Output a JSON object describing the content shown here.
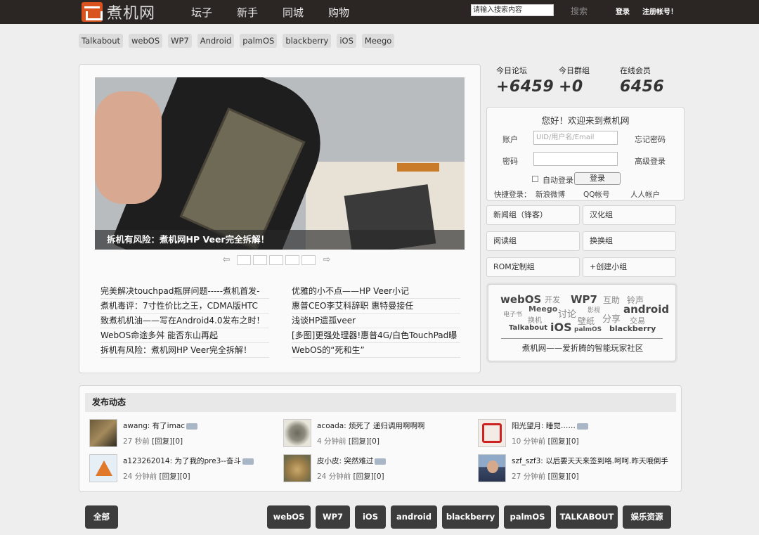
{
  "header": {
    "logo_text": "煮机网",
    "nav": [
      "坛子",
      "新手",
      "同城",
      "购物"
    ],
    "search_placeholder": "请输入搜索内容",
    "search_button": "搜索",
    "login": "登录",
    "register": "注册帐号！"
  },
  "tags": [
    "Talkabout",
    "webOS",
    "WP7",
    "Android",
    "palmOS",
    "blackberry",
    "iOS",
    "Meego"
  ],
  "slider": {
    "caption": "拆机有风险：煮机网HP Veer完全拆解！",
    "prev_arrow": "⇦",
    "next_arrow": "⇨"
  },
  "news_left": [
    "完美解决touchpad瓶屏问题-----煮机首发-",
    "煮机毒评：7寸性价比之王，CDMA版HTC",
    "致煮机机油——写在Android4.0发布之时！",
    "WebOS命途多舛 能否东山再起",
    "拆机有风险：煮机网HP Veer完全拆解！"
  ],
  "news_right": [
    "优雅的小不点——HP Veer小记",
    "惠普CEO李艾科辞职 惠特曼接任",
    "浅谈HP遗孤veer",
    "[多图]更强处理器!惠普4G/白色TouchPad曝",
    "WebOS的“死和生”"
  ],
  "stats": [
    {
      "label": "今日论坛",
      "value": "+6459"
    },
    {
      "label": "今日群组",
      "value": "+0"
    },
    {
      "label": "在线会员",
      "value": "6456"
    }
  ],
  "login": {
    "title": "您好！欢迎来到煮机网",
    "account_label": "账户",
    "account_placeholder": "UID/用户名/Email",
    "forgot": "忘记密码",
    "password_label": "密码",
    "advanced": "高级登录",
    "remember": "自动登录",
    "submit": "登录",
    "quick_label": "快捷登录：",
    "quick_weibo": "新浪微博",
    "quick_qq": "QQ帐号",
    "quick_renren": "人人帐户"
  },
  "groups": [
    "新闻组（锋客）",
    "汉化组",
    "阅读组",
    "换换组",
    "ROM定制组",
    "+创建小组"
  ],
  "cloud": {
    "words": [
      "webOS",
      "开发",
      "WP7",
      "互助",
      "铃声",
      "电子书",
      "Meego",
      "讨论",
      "影视",
      "android",
      "换机",
      "壁纸",
      "分享",
      "交易",
      "Talkabout",
      "iOS",
      "palmOS",
      "blackberry"
    ],
    "caption": "煮机网——爱折腾的智能玩家社区"
  },
  "activity": {
    "title": "发布动态",
    "reply_label": "[回复][0]",
    "items": [
      {
        "user": "awang",
        "text": "有了imac",
        "time": "27 秒前"
      },
      {
        "user": "acoada",
        "text": "烦死了 递归调用啊啊啊",
        "time": "4 分钟前"
      },
      {
        "user": "阳光望月",
        "text": "睡觉……",
        "time": "10 分钟前"
      },
      {
        "user": "a123262014",
        "text": "为了我的pre3--奋斗",
        "time": "24 分钟前"
      },
      {
        "user": "皮小皮",
        "text": "突然难过",
        "time": "24 分钟前"
      },
      {
        "user": "szf_szf3",
        "text": "以后要天天来签到咯.呵呵.昨天哦倒手",
        "time": "27 分钟前"
      }
    ]
  },
  "filters": [
    "全部",
    "webOS",
    "WP7",
    "iOS",
    "android",
    "blackberry",
    "palmOS",
    "TALKABOUT",
    "娱乐资源"
  ],
  "colors": {
    "topbar": "#2b2523",
    "logo_accent": "#d9531e",
    "filter_button": "#3c3c3c"
  }
}
